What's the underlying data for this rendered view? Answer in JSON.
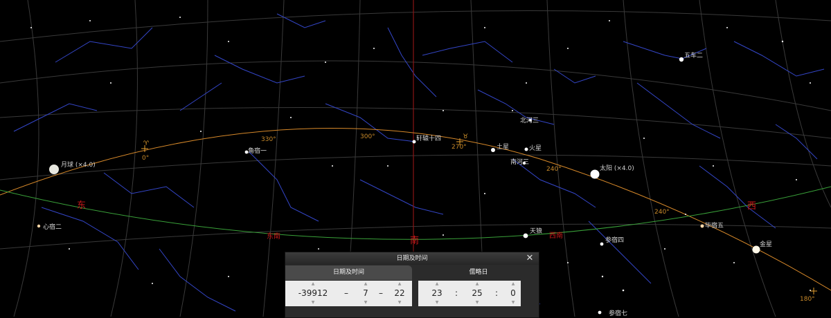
{
  "stars": {
    "wucheer": "五车二",
    "xuanyuan14": "轩辕十四",
    "beihe3": "北河三",
    "nanhe3": "南河三",
    "jiaosu1": "角宿一",
    "xinsu2": "心宿二",
    "tianlang": "天狼",
    "shensu4": "参宿四",
    "shensu5": "毕宿五",
    "shensu7": "参宿七"
  },
  "planets": {
    "moon": "月球 (×4.0)",
    "sun": "太阳 (×4.0)",
    "saturn": "土星",
    "mars": "火星",
    "venus": "金星"
  },
  "cardinals": {
    "east": "东",
    "southeast": "东南",
    "south": "南",
    "southwest": "西南",
    "west": "西",
    "west_partial": "西"
  },
  "ecliptic": {
    "deg_0": "0°",
    "deg_330": "330°",
    "deg_300": "300°",
    "deg_270": "270°",
    "deg_240": "240°",
    "deg_210": "240°",
    "deg_180": "180°",
    "aries_symbol": "♈",
    "taurus_symbol": "♉"
  },
  "dialog": {
    "title": "日期及时间",
    "close_icon": "close-icon",
    "tab_datetime": "日期及时间",
    "tab_julian": "儒略日",
    "year": "-39912",
    "month": "7",
    "day": "22",
    "hour": "23",
    "minute": "25",
    "second": "0",
    "date_sep": "–",
    "time_sep": ":",
    "spin_up_icon": "▲",
    "spin_down_icon": "▼"
  },
  "colors": {
    "ecliptic": "#d98a2a",
    "horizon": "#3aa33a",
    "meridian": "#8a1515",
    "cardinal": "#c8191a",
    "constellation": "#3a4dd0",
    "grid": "#3c3c3c"
  }
}
